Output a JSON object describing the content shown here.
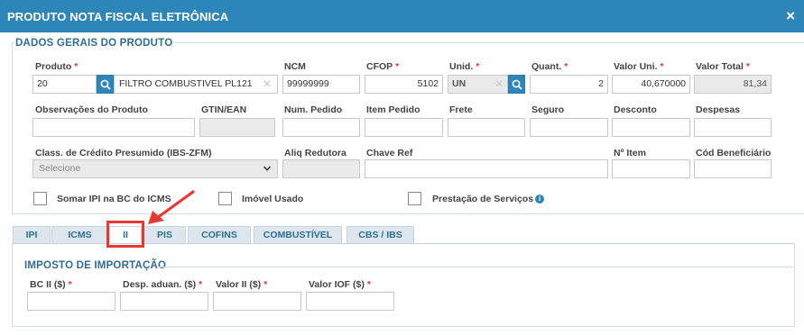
{
  "window": {
    "title": "PRODUTO NOTA FISCAL ELETRÔNICA",
    "close_label": "×"
  },
  "general": {
    "title": "DADOS GERAIS DO PRODUTO",
    "labels": {
      "produto": "Produto",
      "ncm": "NCM",
      "cfop": "CFOP",
      "unid": "Unid.",
      "quant": "Quant.",
      "valor_uni": "Valor Uni.",
      "valor_total": "Valor Total",
      "obs": "Observações do Produto",
      "gtin": "GTIN/EAN",
      "num_pedido": "Num. Pedido",
      "item_pedido": "Item Pedido",
      "frete": "Frete",
      "seguro": "Seguro",
      "desconto": "Desconto",
      "despesas": "Despesas",
      "class_credito": "Class. de Crédito Presumido (IBS-ZFM)",
      "aliq_redutora": "Aliq Redutora",
      "chave_ref": "Chave Ref",
      "n_item": "Nº Item",
      "cod_beneficiario": "Cód Beneficiário"
    },
    "values": {
      "produto_code": "20",
      "produto_desc": "FILTRO COMBUSTIVEL PL121",
      "ncm": "99999999",
      "cfop": "5102",
      "unid": "UN",
      "quant": "2",
      "valor_uni": "40,670000",
      "valor_total": "81,34"
    },
    "class_credito_selected": "Selecione",
    "required_mark": "*",
    "checkboxes": {
      "somar_ipi": "Somar IPI na BC do ICMS",
      "imovel_usado": "Imóvel Usado",
      "prestacao": "Prestação de Serviços"
    },
    "info_glyph": "i"
  },
  "tabs": [
    "IPI",
    "ICMS",
    "II",
    "PIS",
    "COFINS",
    "COMBUSTÍVEL",
    "CBS / IBS"
  ],
  "active_tab": "II",
  "import_tax": {
    "title": "IMPOSTO DE IMPORTAÇÃO",
    "labels": {
      "bc_ii": "BC II ($)",
      "desp_aduan": "Desp. aduan. ($)",
      "valor_ii": "Valor II ($)",
      "valor_iof": "Valor IOF ($)"
    }
  },
  "annotation": {
    "color": "#e53935"
  },
  "colors": {
    "header": "#2e86b8",
    "section_title": "#2e6d96",
    "required": "#e53935",
    "tab_bg": "#dde6ec"
  },
  "icons": {
    "search": "search-icon",
    "close": "close-icon",
    "clear": "clear-icon",
    "dropdown": "chevron-down-icon",
    "info": "info-icon",
    "arrow": "annotation-arrow"
  }
}
